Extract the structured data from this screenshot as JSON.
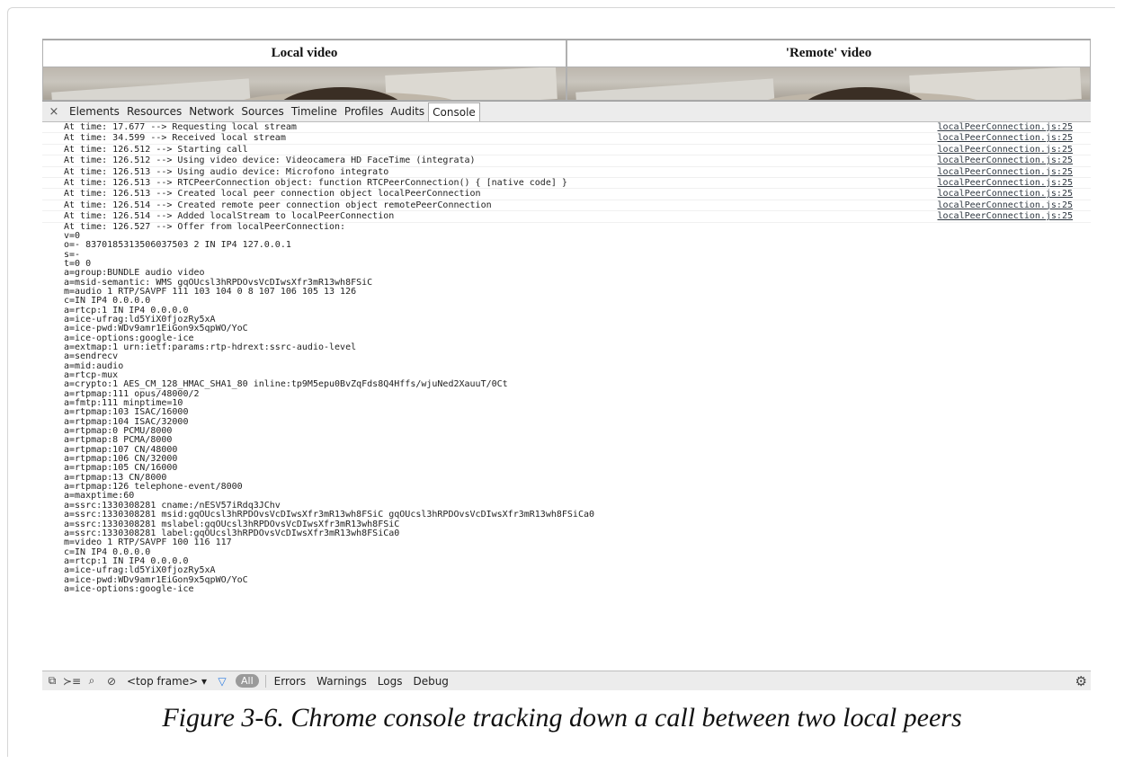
{
  "video": {
    "local_title": "Local video",
    "remote_title": "'Remote' video"
  },
  "devtools": {
    "close_icon": "×",
    "tabs": [
      "Elements",
      "Resources",
      "Network",
      "Sources",
      "Timeline",
      "Profiles",
      "Audits",
      "Console"
    ],
    "active_tab": "Console"
  },
  "console": {
    "logs": [
      {
        "text": "At time: 17.677 --> Requesting local stream",
        "source": "localPeerConnection.js:25"
      },
      {
        "text": "At time: 34.599 --> Received local stream",
        "source": "localPeerConnection.js:25"
      },
      {
        "text": "At time: 126.512 --> Starting call",
        "source": "localPeerConnection.js:25"
      },
      {
        "text": "At time: 126.512 --> Using video device: Videocamera HD FaceTime (integrata)",
        "source": "localPeerConnection.js:25"
      },
      {
        "text": "At time: 126.513 --> Using audio device: Microfono integrato",
        "source": "localPeerConnection.js:25"
      },
      {
        "text": "At time: 126.513 --> RTCPeerConnection object: function RTCPeerConnection() { [native code] }",
        "source": "localPeerConnection.js:25"
      },
      {
        "text": "At time: 126.513 --> Created local peer connection object localPeerConnection",
        "source": "localPeerConnection.js:25"
      },
      {
        "text": "At time: 126.514 --> Created remote peer connection object remotePeerConnection",
        "source": "localPeerConnection.js:25"
      },
      {
        "text": "At time: 126.514 --> Added localStream to localPeerConnection",
        "source": "localPeerConnection.js:25"
      }
    ],
    "sdp_lines": [
      "At time: 126.527 --> Offer from localPeerConnection:",
      "v=0",
      "o=- 8370185313506037503 2 IN IP4 127.0.0.1",
      "s=-",
      "t=0 0",
      "a=group:BUNDLE audio video",
      "a=msid-semantic: WMS gqOUcsl3hRPDOvsVcDIwsXfr3mR13wh8FSiC",
      "m=audio 1 RTP/SAVPF 111 103 104 0 8 107 106 105 13 126",
      "c=IN IP4 0.0.0.0",
      "a=rtcp:1 IN IP4 0.0.0.0",
      "a=ice-ufrag:ld5YiX0fjozRy5xA",
      "a=ice-pwd:WDv9amr1EiGon9x5qpWO/YoC",
      "a=ice-options:google-ice",
      "a=extmap:1 urn:ietf:params:rtp-hdrext:ssrc-audio-level",
      "a=sendrecv",
      "a=mid:audio",
      "a=rtcp-mux",
      "a=crypto:1 AES_CM_128_HMAC_SHA1_80 inline:tp9M5epu0BvZqFds8Q4Hffs/wjuNed2XauuT/0Ct",
      "a=rtpmap:111 opus/48000/2",
      "a=fmtp:111 minptime=10",
      "a=rtpmap:103 ISAC/16000",
      "a=rtpmap:104 ISAC/32000",
      "a=rtpmap:0 PCMU/8000",
      "a=rtpmap:8 PCMA/8000",
      "a=rtpmap:107 CN/48000",
      "a=rtpmap:106 CN/32000",
      "a=rtpmap:105 CN/16000",
      "a=rtpmap:13 CN/8000",
      "a=rtpmap:126 telephone-event/8000",
      "a=maxptime:60",
      "a=ssrc:1330308281 cname:/nESV57iRdq3JChv",
      "a=ssrc:1330308281 msid:gqOUcsl3hRPDOvsVcDIwsXfr3mR13wh8FSiC gqOUcsl3hRPDOvsVcDIwsXfr3mR13wh8FSiCa0",
      "a=ssrc:1330308281 mslabel:gqOUcsl3hRPDOvsVcDIwsXfr3mR13wh8FSiC",
      "a=ssrc:1330308281 label:gqOUcsl3hRPDOvsVcDIwsXfr3mR13wh8FSiCa0",
      "m=video 1 RTP/SAVPF 100 116 117",
      "c=IN IP4 0.0.0.0",
      "a=rtcp:1 IN IP4 0.0.0.0",
      "a=ice-ufrag:ld5YiX0fjozRy5xA",
      "a=ice-pwd:WDv9amr1EiGon9x5qpWO/YoC",
      "a=ice-options:google-ice"
    ]
  },
  "statusbar": {
    "frame_select": "<top frame> ▾",
    "all_label": "All",
    "filters": [
      "Errors",
      "Warnings",
      "Logs",
      "Debug"
    ]
  },
  "caption": "Figure 3-6. Chrome console tracking down a call between two local peers"
}
